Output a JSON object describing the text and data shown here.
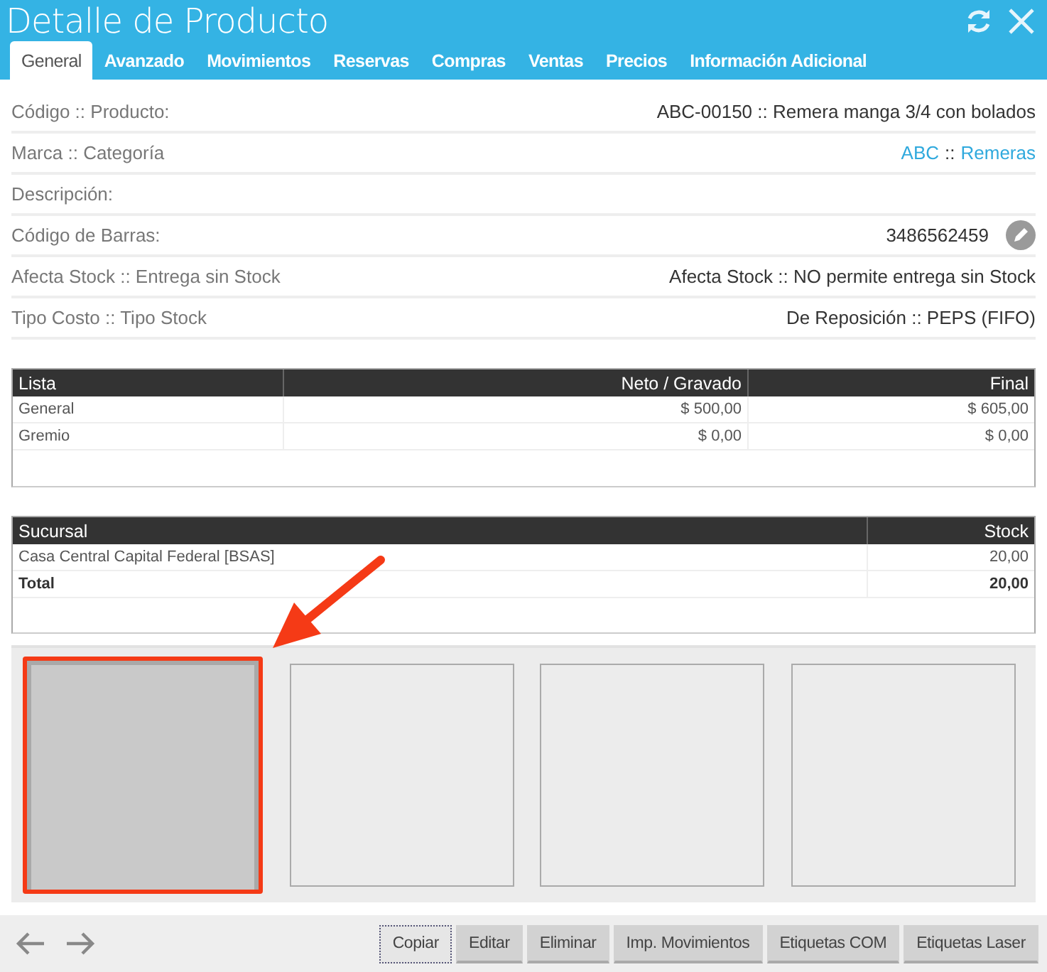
{
  "window": {
    "title": "Detalle de Producto"
  },
  "tabs": [
    {
      "label": "General",
      "selected": true
    },
    {
      "label": "Avanzado",
      "selected": false
    },
    {
      "label": "Movimientos",
      "selected": false
    },
    {
      "label": "Reservas",
      "selected": false
    },
    {
      "label": "Compras",
      "selected": false
    },
    {
      "label": "Ventas",
      "selected": false
    },
    {
      "label": "Precios",
      "selected": false
    },
    {
      "label": "Información Adicional",
      "selected": false
    }
  ],
  "fields": [
    {
      "kind": "text",
      "label": "Código :: Producto:",
      "value": "ABC-00150 :: Remera manga 3/4 con bolados"
    },
    {
      "kind": "links",
      "label": "Marca :: Categoría",
      "links": [
        "ABC",
        "Remeras"
      ],
      "separator": "::"
    },
    {
      "kind": "text",
      "label": "Descripción:"
    },
    {
      "kind": "editable",
      "label": "Código de Barras:",
      "value": "3486562459"
    },
    {
      "kind": "text",
      "label": "Afecta Stock :: Entrega sin Stock",
      "value": "Afecta Stock :: NO permite entrega sin Stock"
    },
    {
      "kind": "text",
      "label": "Tipo Costo :: Tipo Stock",
      "value": "De Reposición :: PEPS (FIFO)"
    }
  ],
  "price_table": {
    "columns": [
      "Lista",
      "Neto / Gravado",
      "Final"
    ],
    "rows": [
      {
        "kind": "item",
        "cells": [
          "General",
          "$ 500,00",
          "$ 605,00"
        ]
      },
      {
        "kind": "item",
        "cells": [
          "Gremio",
          "$ 0,00",
          "$ 0,00"
        ]
      }
    ]
  },
  "stock_table": {
    "columns": [
      "Sucursal",
      "Stock"
    ],
    "rows": [
      {
        "kind": "item",
        "cells": [
          "Casa Central Capital Federal [BSAS]",
          "20,00"
        ]
      },
      {
        "kind": "total",
        "cells": [
          "Total",
          "20,00"
        ]
      }
    ]
  },
  "images": [
    {
      "highlighted": true
    },
    {
      "highlighted": false
    },
    {
      "highlighted": false
    },
    {
      "highlighted": false
    }
  ],
  "buttons": [
    {
      "label": "Copiar",
      "focused": true
    },
    {
      "label": "Editar",
      "focused": false
    },
    {
      "label": "Eliminar",
      "focused": false
    },
    {
      "label": "Imp. Movimientos",
      "focused": false
    },
    {
      "label": "Etiquetas COM",
      "focused": false
    },
    {
      "label": "Etiquetas Laser",
      "focused": false
    }
  ]
}
